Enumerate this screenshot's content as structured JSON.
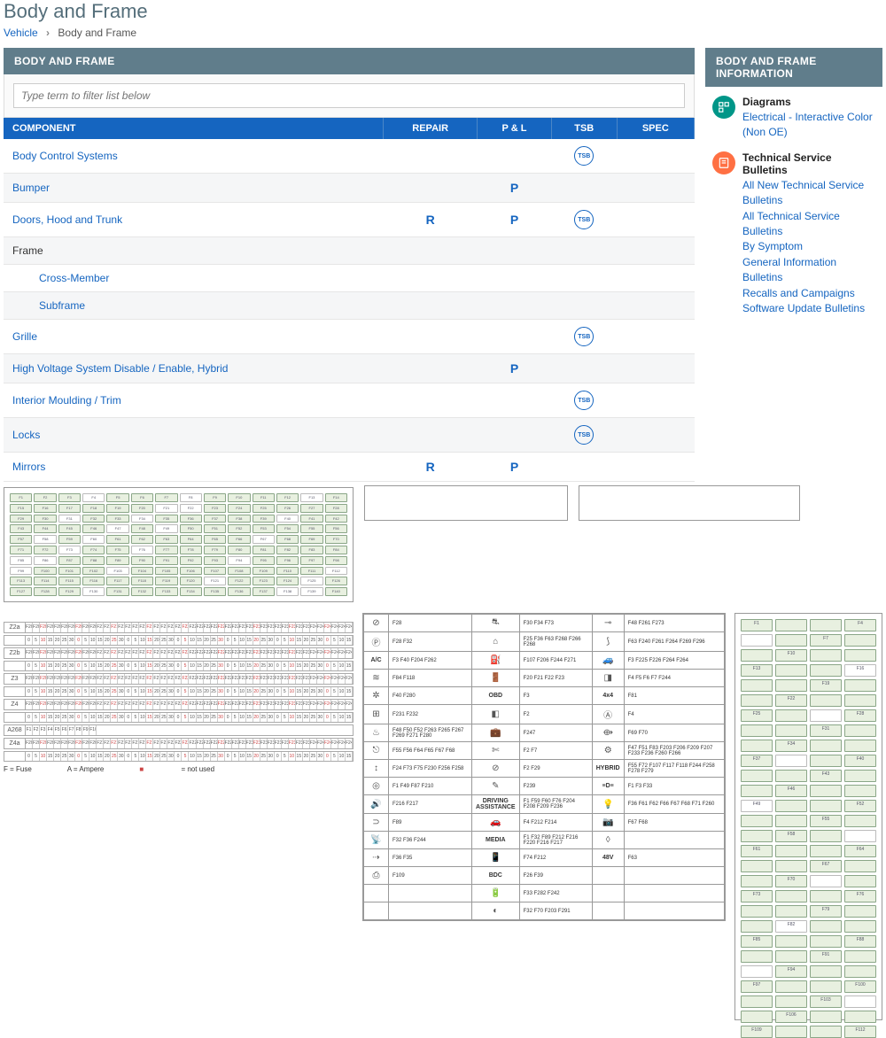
{
  "page_title": "Body and Frame",
  "breadcrumb": {
    "root": "Vehicle",
    "current": "Body and Frame"
  },
  "panel_title": "BODY AND FRAME",
  "filter_placeholder": "Type term to filter list below",
  "columns": {
    "component": "COMPONENT",
    "repair": "REPAIR",
    "pl": "P & L",
    "tsb": "TSB",
    "spec": "SPEC"
  },
  "badge_tsb": "TSB",
  "rows": [
    {
      "label": "Body Control Systems",
      "repair": "",
      "pl": "",
      "tsb": true,
      "link": true
    },
    {
      "label": "Bumper",
      "repair": "",
      "pl": "P",
      "tsb": false,
      "link": true
    },
    {
      "label": "Doors, Hood and Trunk",
      "repair": "R",
      "pl": "P",
      "tsb": true,
      "link": true
    },
    {
      "label": "Frame",
      "repair": "",
      "pl": "",
      "tsb": false,
      "link": false,
      "plain": true
    },
    {
      "label": "Cross-Member",
      "repair": "",
      "pl": "",
      "tsb": false,
      "link": true,
      "indent": true
    },
    {
      "label": "Subframe",
      "repair": "",
      "pl": "",
      "tsb": false,
      "link": true,
      "indent": true
    },
    {
      "label": "Grille",
      "repair": "",
      "pl": "",
      "tsb": true,
      "link": true
    },
    {
      "label": "High Voltage System Disable / Enable, Hybrid",
      "repair": "",
      "pl": "P",
      "tsb": false,
      "link": true
    },
    {
      "label": "Interior Moulding / Trim",
      "repair": "",
      "pl": "",
      "tsb": true,
      "link": true
    },
    {
      "label": "Locks",
      "repair": "",
      "pl": "",
      "tsb": true,
      "link": true
    },
    {
      "label": "Mirrors",
      "repair": "R",
      "pl": "P",
      "tsb": false,
      "link": true
    }
  ],
  "info_panel_title": "BODY AND FRAME INFORMATION",
  "info": {
    "diagrams": {
      "title": "Diagrams",
      "links": [
        "Electrical - Interactive Color (Non OE)"
      ]
    },
    "tsb": {
      "title": "Technical Service Bulletins",
      "links": [
        "All New Technical Service Bulletins",
        "All Technical Service Bulletins",
        "By Symptom",
        "General Information Bulletins",
        "Recalls and Campaigns",
        "Software Update Bulletins"
      ]
    }
  },
  "strip_labels": [
    "Z2a",
    "Z2b",
    "Z3",
    "Z4",
    "Z4a"
  ],
  "a268": "A268",
  "legend": {
    "fuse": "F = Fuse",
    "amp": "A = Ampere",
    "nu": "= not used"
  },
  "sym_left": [
    {
      "ico": "⊘",
      "codes": "F28"
    },
    {
      "ico": "Ⓟ",
      "codes": "F28  F32"
    },
    {
      "lbl": "A/C",
      "codes": "F3  F40  F204 F262"
    },
    {
      "ico": "≋",
      "codes": "F84  F118"
    },
    {
      "ico": "✲",
      "codes": "F40  F280"
    },
    {
      "ico": "⊞",
      "codes": "F231 F232"
    },
    {
      "ico": "♨",
      "codes": "F48  F50  F52  F263  F265  F267  F269  F271  F280"
    },
    {
      "ico": "⎋",
      "codes": "F55  F56  F64  F65  F67  F68"
    },
    {
      "ico": "↕",
      "codes": "F24  F73  F75  F230  F256  F258"
    },
    {
      "ico": "◎",
      "codes": "F1  F49  F87  F210"
    },
    {
      "ico": "🔊",
      "codes": "F216 F217"
    },
    {
      "ico": "⊃",
      "codes": "F89"
    },
    {
      "ico": "📡",
      "codes": "F32  F36  F244"
    },
    {
      "ico": "⇢",
      "codes": "F36  F35"
    },
    {
      "ico": "⎙",
      "codes": "F109"
    }
  ],
  "sym_mid": [
    {
      "ico": "⛐",
      "codes": "F30  F34  F73"
    },
    {
      "ico": "⌂",
      "codes": "F25  F36  F63  F268  F266  F268"
    },
    {
      "ico": "⛽",
      "codes": "F107 F206 F244 F271"
    },
    {
      "ico": "🚪",
      "codes": "F20  F21  F22  F23"
    },
    {
      "lbl": "OBD",
      "codes": "F3"
    },
    {
      "ico": "◧",
      "codes": "F2"
    },
    {
      "ico": "💼",
      "codes": "F247"
    },
    {
      "ico": "✄",
      "codes": "F2  F7"
    },
    {
      "ico": "⊘",
      "codes": "F2  F29"
    },
    {
      "ico": "✎",
      "codes": "F239"
    },
    {
      "lbl": "DRIVING ASSISTANCE",
      "codes": "F1  F59  F60  F76  F204  F208  F209 F236"
    },
    {
      "ico": "🚗",
      "codes": "F4  F212 F214"
    },
    {
      "lbl": "MEDIA",
      "codes": "F1  F32  F89  F212  F216  F220  F216 F217"
    },
    {
      "ico": "📱",
      "codes": "F74  F212"
    },
    {
      "lbl": "BDC",
      "codes": "F26  F39"
    },
    {
      "ico": "🔋",
      "codes": "F33  F282 F242"
    },
    {
      "ico": "◐",
      "codes": "F32  F70  F203 F291"
    }
  ],
  "sym_right": [
    {
      "ico": "⊸",
      "codes": "F48  F261 F273"
    },
    {
      "ico": "⟆",
      "codes": "F63  F240  F261  F264  F269  F296"
    },
    {
      "ico": "🚙",
      "codes": "F3  F225 F226 F264 F264"
    },
    {
      "ico": "◨",
      "codes": "F4  F5  F6  F7  F244"
    },
    {
      "lbl": "4x4",
      "codes": "F81"
    },
    {
      "ico": "Ⓐ",
      "codes": "F4"
    },
    {
      "ico": "⟴",
      "codes": "F69  F70"
    },
    {
      "ico": "⚙",
      "codes": "F47  F51  F83 F203  F206  F209 F207  F233  F236 F260  F266"
    },
    {
      "lbl": "HYBRID",
      "codes": "F55  F72  F107 F117  F118  F244 F258  F278  F279"
    },
    {
      "lbl": "≡D≡",
      "codes": "F1  F3  F33"
    },
    {
      "ico": "💡",
      "codes": "F36  F61  F62  F66 F67  F68  F71  F260"
    },
    {
      "ico": "📷",
      "codes": "F67  F68"
    },
    {
      "ico": "◊",
      "codes": ""
    },
    {
      "lbl": "48V",
      "codes": "F63"
    }
  ]
}
